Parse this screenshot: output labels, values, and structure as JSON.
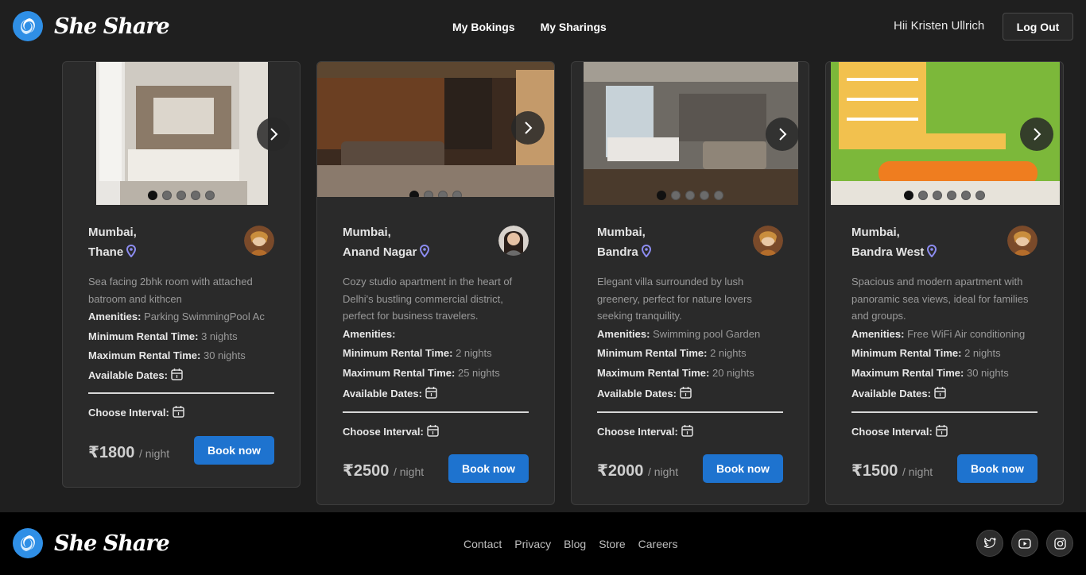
{
  "header": {
    "brand": "She Share",
    "nav": [
      "My Bokings",
      "My Sharings"
    ],
    "greeting": "Hii Kristen Ullrich",
    "logout_label": "Log Out"
  },
  "labels": {
    "amenities": "Amenities:",
    "min_rental": "Minimum Rental Time:",
    "max_rental": "Maximum Rental Time:",
    "available_dates": "Available Dates:",
    "choose_interval": "Choose Interval:",
    "per_night": "/ night",
    "book": "Book now"
  },
  "listings": [
    {
      "city": "Mumbai,",
      "area": "Thane",
      "description": "Sea facing 2bhk room with attached batroom and kithcen",
      "amenities": "Parking SwimmingPool Ac",
      "min_rental": "3 nights",
      "max_rental": "30 nights",
      "price": "₹1800",
      "image_count": 5
    },
    {
      "city": "Mumbai,",
      "area": "Anand Nagar",
      "description": "Cozy studio apartment in the heart of Delhi's bustling commercial district, perfect for business travelers.",
      "amenities": "",
      "min_rental": "2 nights",
      "max_rental": "25 nights",
      "price": "₹2500",
      "image_count": 4
    },
    {
      "city": "Mumbai,",
      "area": "Bandra",
      "description": "Elegant villa surrounded by lush greenery, perfect for nature lovers seeking tranquility.",
      "amenities": "Swimming pool Garden",
      "min_rental": "2 nights",
      "max_rental": "20 nights",
      "price": "₹2000",
      "image_count": 5
    },
    {
      "city": "Mumbai,",
      "area": "Bandra West",
      "description": "Spacious and modern apartment with panoramic sea views, ideal for families and groups.",
      "amenities": "Free WiFi Air conditioning",
      "min_rental": "2 nights",
      "max_rental": "30 nights",
      "price": "₹1500",
      "image_count": 6
    }
  ],
  "footer": {
    "brand": "She Share",
    "links": [
      "Contact",
      "Privacy",
      "Blog",
      "Store",
      "Careers"
    ],
    "social_icons": [
      "twitter-icon",
      "youtube-icon",
      "instagram-icon"
    ]
  },
  "colors": {
    "accent": "#1e73cf",
    "logo": "#2f8fe6",
    "pin": "#8c8cf0",
    "background": "#1f1f1f"
  }
}
